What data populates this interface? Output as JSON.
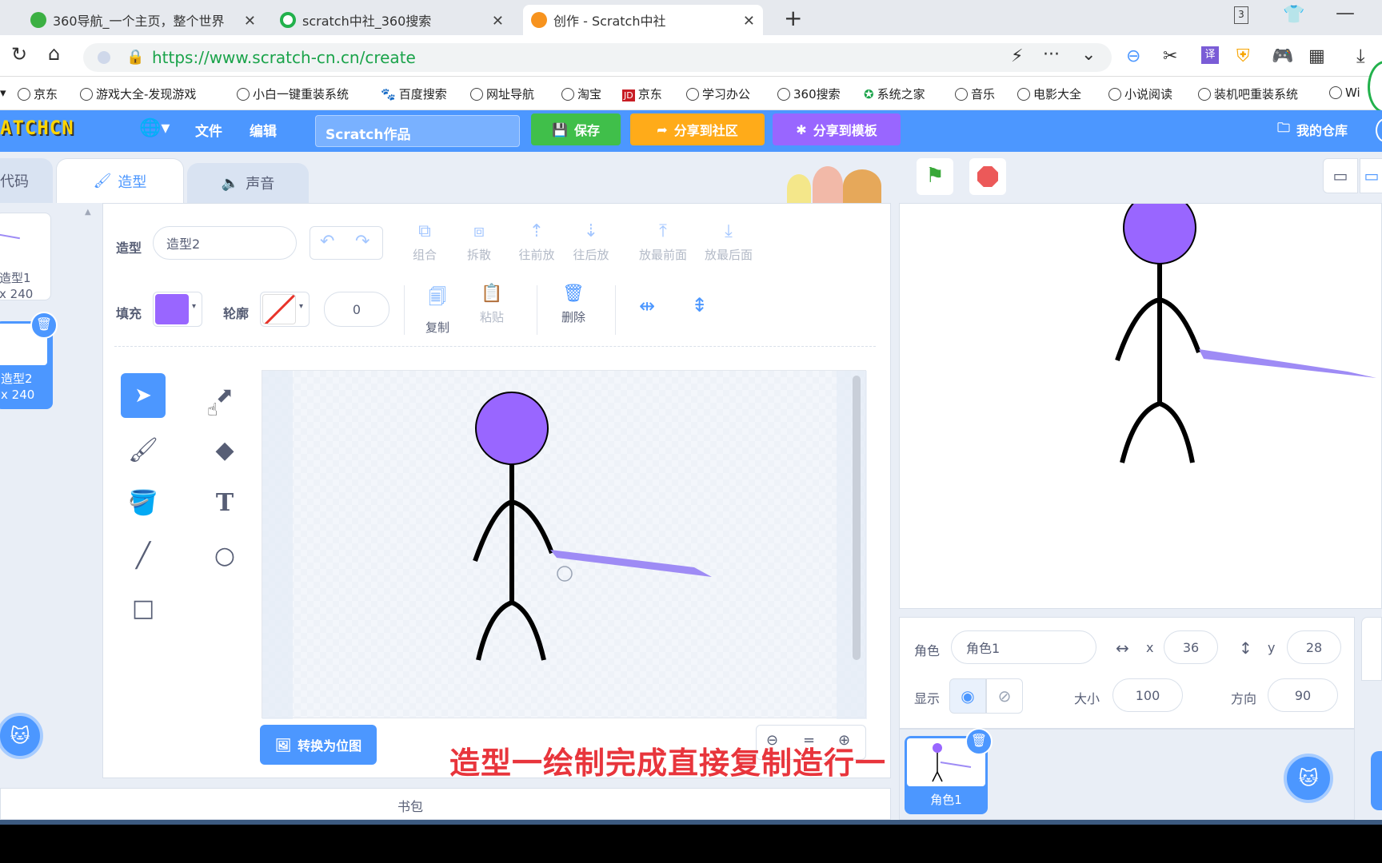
{
  "browser": {
    "tabs": [
      {
        "title": "360导航_一个主页，整个世界"
      },
      {
        "title": "scratch中社_360搜索"
      },
      {
        "title": "创作 - Scratch中社"
      }
    ],
    "tab_count_badge": "3",
    "url": "https://www.scratch-cn.cn/create",
    "bookmarks": [
      "京东",
      "游戏大全-发现游戏",
      "小白一键重装系统",
      "百度搜索",
      "网址导航",
      "淘宝",
      "京东",
      "学习办公",
      "360搜索",
      "系统之家",
      "音乐",
      "电影大全",
      "小说阅读",
      "装机吧重装系统",
      "Wi"
    ]
  },
  "menubar": {
    "logo": "ATCHCN",
    "file": "文件",
    "edit": "编辑",
    "project_title": "Scratch作品",
    "save": "保存",
    "share_community": "分享到社区",
    "share_template": "分享到模板",
    "my_stuff": "我的仓库"
  },
  "editor_tabs": {
    "code": "代码",
    "costumes": "造型",
    "sounds": "声音"
  },
  "costumes": [
    {
      "name": "造型1",
      "size": "x 240"
    },
    {
      "name": "造型2",
      "size": "x 240"
    }
  ],
  "paint": {
    "costume_label": "造型",
    "costume_name": "造型2",
    "group": "组合",
    "ungroup": "拆散",
    "forward": "往前放",
    "backward": "往后放",
    "front": "放最前面",
    "back": "放最后面",
    "fill_label": "填充",
    "outline_label": "轮廓",
    "outline_width": "0",
    "copy": "复制",
    "paste": "粘贴",
    "delete": "删除",
    "convert_bitmap": "转换为位图",
    "fill_color": "#9966ff",
    "sword_color": "#9e8bf5"
  },
  "sprite_info": {
    "sprite_label": "角色",
    "sprite_name": "角色1",
    "x_label": "x",
    "x": "36",
    "y_label": "y",
    "y": "28",
    "show_label": "显示",
    "size_label": "大小",
    "size": "100",
    "direction_label": "方向",
    "direction": "90"
  },
  "sprite_list": [
    {
      "name": "角色1"
    }
  ],
  "backpack": "书包",
  "subtitle": "造型一绘制完成直接复制造行一"
}
